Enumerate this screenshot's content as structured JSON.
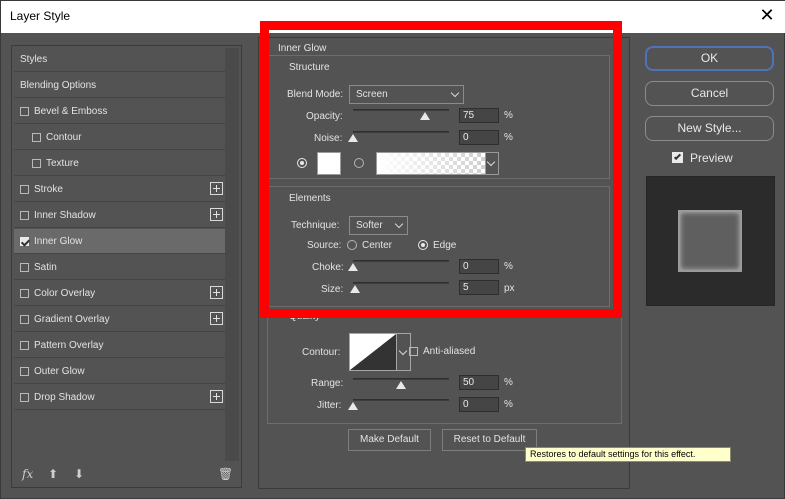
{
  "window": {
    "title": "Layer Style",
    "close_glyph": "✕"
  },
  "sidebar": {
    "items": [
      {
        "label": "Styles",
        "checkbox": false,
        "checked": false,
        "plus": false,
        "indent": 0,
        "selected": false
      },
      {
        "label": "Blending Options",
        "checkbox": false,
        "checked": false,
        "plus": false,
        "indent": 0,
        "selected": false
      },
      {
        "label": "Bevel & Emboss",
        "checkbox": true,
        "checked": false,
        "plus": false,
        "indent": 0,
        "selected": false
      },
      {
        "label": "Contour",
        "checkbox": true,
        "checked": false,
        "plus": false,
        "indent": 1,
        "selected": false
      },
      {
        "label": "Texture",
        "checkbox": true,
        "checked": false,
        "plus": false,
        "indent": 1,
        "selected": false
      },
      {
        "label": "Stroke",
        "checkbox": true,
        "checked": false,
        "plus": true,
        "indent": 0,
        "selected": false
      },
      {
        "label": "Inner Shadow",
        "checkbox": true,
        "checked": false,
        "plus": true,
        "indent": 0,
        "selected": false
      },
      {
        "label": "Inner Glow",
        "checkbox": true,
        "checked": true,
        "plus": false,
        "indent": 0,
        "selected": true
      },
      {
        "label": "Satin",
        "checkbox": true,
        "checked": false,
        "plus": false,
        "indent": 0,
        "selected": false
      },
      {
        "label": "Color Overlay",
        "checkbox": true,
        "checked": false,
        "plus": true,
        "indent": 0,
        "selected": false
      },
      {
        "label": "Gradient Overlay",
        "checkbox": true,
        "checked": false,
        "plus": true,
        "indent": 0,
        "selected": false
      },
      {
        "label": "Pattern Overlay",
        "checkbox": true,
        "checked": false,
        "plus": false,
        "indent": 0,
        "selected": false
      },
      {
        "label": "Outer Glow",
        "checkbox": true,
        "checked": false,
        "plus": false,
        "indent": 0,
        "selected": false
      },
      {
        "label": "Drop Shadow",
        "checkbox": true,
        "checked": false,
        "plus": true,
        "indent": 0,
        "selected": false
      }
    ],
    "footer": {
      "fx": "fx",
      "up": "⬆",
      "down": "⬇",
      "trash": "🗑"
    }
  },
  "inner_glow": {
    "section_title": "Inner Glow",
    "structure": {
      "title": "Structure",
      "blend_mode_label": "Blend Mode:",
      "blend_mode_value": "Screen",
      "opacity_label": "Opacity:",
      "opacity_value": "75",
      "opacity_level": 0.75,
      "noise_label": "Noise:",
      "noise_value": "0",
      "noise_level": 0,
      "percent": "%"
    },
    "elements": {
      "title": "Elements",
      "technique_label": "Technique:",
      "technique_value": "Softer",
      "source_label": "Source:",
      "source_center": "Center",
      "source_edge": "Edge",
      "choke_label": "Choke:",
      "choke_value": "0",
      "choke_level": 0,
      "size_label": "Size:",
      "size_value": "5",
      "size_level": 0.02,
      "percent": "%",
      "px": "px"
    },
    "quality": {
      "title": "Quality",
      "contour_label": "Contour:",
      "anti_aliased": "Anti-aliased",
      "range_label": "Range:",
      "range_value": "50",
      "range_level": 0.5,
      "jitter_label": "Jitter:",
      "jitter_value": "0",
      "jitter_level": 0,
      "percent": "%"
    },
    "make_default": "Make Default",
    "reset_default": "Reset to Default"
  },
  "right": {
    "ok": "OK",
    "cancel": "Cancel",
    "new_style": "New Style...",
    "preview": "Preview"
  },
  "tooltip": "Restores to default settings for this effect.",
  "colors": {
    "accent": "#4d74b8",
    "highlight": "#ff0000",
    "glow_color": "#ffffff"
  }
}
